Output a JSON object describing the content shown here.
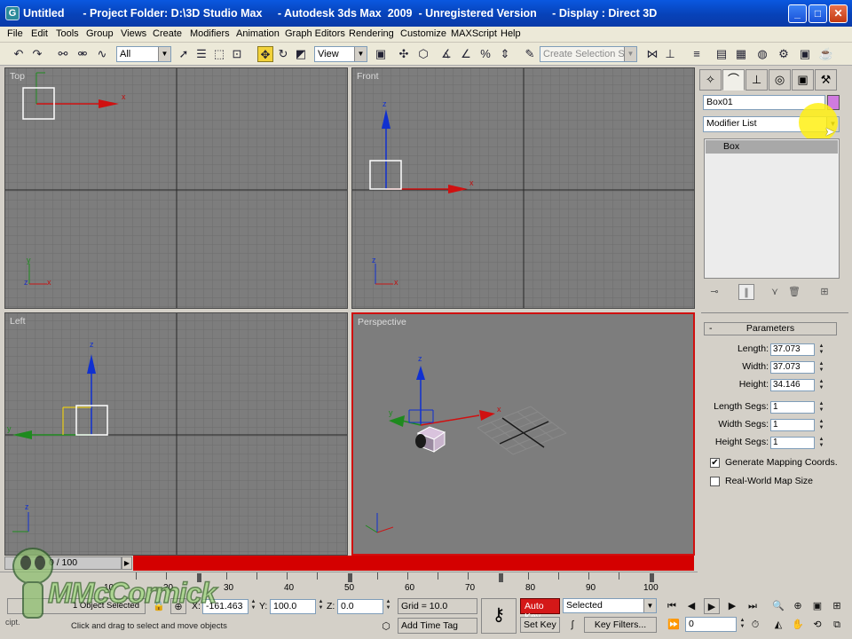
{
  "window": {
    "title": "Untitled      - Project Folder: D:\\3D Studio Max     - Autodesk 3ds Max  2009  - Unregistered Version     - Display : Direct 3D",
    "minimize": "_",
    "maximize": "□",
    "close": "✕"
  },
  "menu": [
    "File",
    "Edit",
    "Tools",
    "Group",
    "Views",
    "Create",
    "Modifiers",
    "Animation",
    "Graph Editors",
    "Rendering",
    "Customize",
    "MAXScript",
    "Help"
  ],
  "toolbar": {
    "selection_filter": "All",
    "reference_coord": "View",
    "named_selection_placeholder": "Create Selection Set",
    "icons": [
      "undo-icon",
      "redo-icon",
      "select-link-icon",
      "unlink-icon",
      "bind-spacewarp-icon",
      "select-object-icon",
      "select-region-icon",
      "window-crossing-icon",
      "move-icon",
      "rotate-icon",
      "scale-icon",
      "pivot-icon",
      "manipulate-icon",
      "snap-toggle-icon",
      "angle-snap-icon",
      "percent-snap-icon",
      "spinner-snap-icon",
      "edit-named-selection-icon",
      "mirror-icon",
      "align-icon",
      "layer-manager-icon",
      "curve-editor-icon",
      "schematic-view-icon",
      "material-editor-icon",
      "render-setup-icon",
      "rendered-frame-icon",
      "quick-render-icon"
    ]
  },
  "viewports": {
    "top": {
      "label": "Top"
    },
    "front": {
      "label": "Front"
    },
    "left": {
      "label": "Left"
    },
    "perspective": {
      "label": "Perspective"
    }
  },
  "axes": {
    "x": "x",
    "y": "y",
    "z": "z"
  },
  "command_panel": {
    "tabs": [
      "create-tab-icon",
      "modify-tab-icon",
      "hierarchy-tab-icon",
      "motion-tab-icon",
      "display-tab-icon",
      "utilities-tab-icon"
    ],
    "object_name": "Box01",
    "object_color": "#d07be0",
    "modifier_list": "Modifier List",
    "stack_item": "Box",
    "rollout_title": "Parameters",
    "rollout_toggle": "-",
    "params": [
      {
        "label": "Length:",
        "value": "37.073"
      },
      {
        "label": "Width:",
        "value": "37.073"
      },
      {
        "label": "Height:",
        "value": "34.146"
      }
    ],
    "segs": [
      {
        "label": "Length Segs:",
        "value": "1"
      },
      {
        "label": "Width Segs:",
        "value": "1"
      },
      {
        "label": "Height Segs:",
        "value": "1"
      }
    ],
    "checkboxes": [
      {
        "label": "Generate Mapping Coords.",
        "checked": true,
        "mark": "✔"
      },
      {
        "label": "Real-World Map Size",
        "checked": false,
        "mark": ""
      }
    ]
  },
  "timeline": {
    "slider_text": "0 / 100",
    "slider_arrow": "▶",
    "ticks": [
      "10",
      "20",
      "30",
      "40",
      "50",
      "60",
      "70",
      "80",
      "90",
      "100"
    ]
  },
  "status": {
    "selection_info": "1 Object Selected",
    "prompt": "Click and drag to select and move objects",
    "script_label": "cipt.",
    "coord_x_label": "X:",
    "coord_x": "-161.463",
    "coord_y_label": "Y:",
    "coord_y": "100.0",
    "coord_z_label": "Z:",
    "coord_z": "0.0",
    "grid": "Grid = 10.0",
    "add_time_tag": "Add Time Tag",
    "auto_key": "Auto Key",
    "set_key": "Set Key",
    "key_mode": "Selected",
    "key_filters": "Key Filters...",
    "frame": "0"
  },
  "watermark": {
    "text": "MMcCormick"
  }
}
